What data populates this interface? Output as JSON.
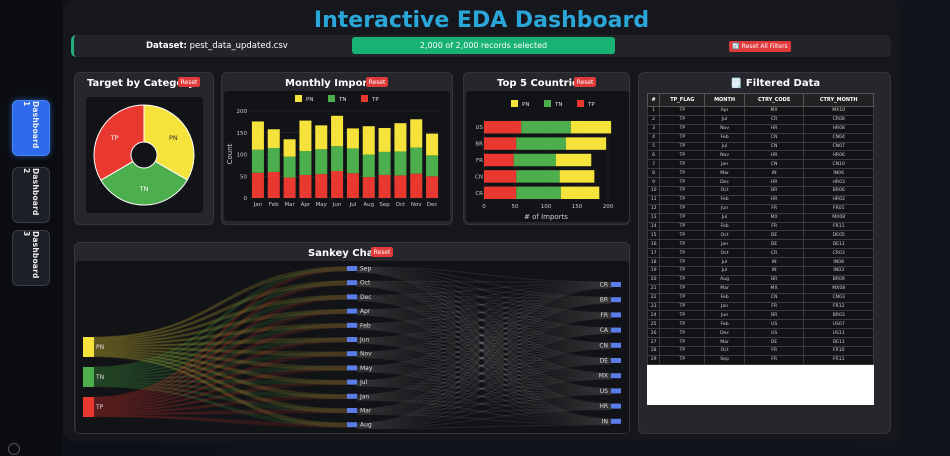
{
  "title": "Interactive EDA Dashboard",
  "nav": [
    {
      "label": "Dashboard 1"
    },
    {
      "label": "Dashboard 2"
    },
    {
      "label": "Dashboard 3"
    }
  ],
  "topbar": {
    "dataset_label": "Dataset:",
    "dataset_file": "pest_data_updated.csv",
    "records": "2,000 of 2,000 records selected",
    "reset_all": "🔄 Reset All Filters"
  },
  "reset_label": "Reset",
  "colors": {
    "PN": "#f5e23a",
    "TN": "#4cae4c",
    "TP": "#e8382f",
    "accent": "#2ba6d8",
    "green": "#19b275",
    "red": "#e03a3a"
  },
  "panels": {
    "target": "Target by Category",
    "monthly": "Monthly Imports",
    "countries": "Top 5 Countries",
    "filtered": "🗒️ Filtered Data",
    "sankey": "Sankey Chart"
  },
  "chart_data": [
    {
      "type": "pie",
      "title": "Target by Category",
      "labels": [
        "PN",
        "TN",
        "TP"
      ],
      "values": [
        33.3,
        33.3,
        33.4
      ],
      "donut": true
    },
    {
      "type": "bar",
      "title": "Monthly Imports",
      "stacked": true,
      "categories": [
        "Jan",
        "Feb",
        "Mar",
        "Apr",
        "May",
        "Jun",
        "Jul",
        "Aug",
        "Sep",
        "Oct",
        "Nov",
        "Dec"
      ],
      "series": [
        {
          "name": "TP",
          "values": [
            58,
            60,
            47,
            53,
            55,
            62,
            57,
            48,
            53,
            52,
            56,
            50
          ]
        },
        {
          "name": "TN",
          "values": [
            53,
            55,
            48,
            55,
            57,
            57,
            57,
            52,
            53,
            55,
            60,
            48
          ]
        },
        {
          "name": "PN",
          "values": [
            65,
            43,
            40,
            70,
            55,
            70,
            46,
            65,
            55,
            65,
            65,
            50
          ]
        }
      ],
      "xlabel": "",
      "ylabel": "Count",
      "ylim": [
        0,
        200
      ],
      "yticks": [
        0,
        50,
        100,
        150,
        200
      ]
    },
    {
      "type": "bar",
      "title": "Top 5 Countries",
      "horizontal": true,
      "stacked": true,
      "categories": [
        "US",
        "BR",
        "FR",
        "CN",
        "CR"
      ],
      "series": [
        {
          "name": "TP",
          "values": [
            60,
            52,
            48,
            52,
            52
          ]
        },
        {
          "name": "TN",
          "values": [
            80,
            80,
            68,
            70,
            72
          ]
        },
        {
          "name": "PN",
          "values": [
            65,
            65,
            57,
            56,
            62
          ]
        }
      ],
      "xlabel": "# of Imports",
      "xlim": [
        0,
        200
      ],
      "xticks": [
        0,
        50,
        100,
        150,
        200
      ]
    },
    {
      "type": "sankey",
      "title": "Sankey Chart",
      "sources": [
        "PN",
        "TN",
        "TP"
      ],
      "months": [
        "Sep",
        "Oct",
        "Dec",
        "Apr",
        "Feb",
        "Jun",
        "Nov",
        "May",
        "Jul",
        "Jan",
        "Mar",
        "Aug"
      ],
      "countries": [
        "CR",
        "BR",
        "FR",
        "CA",
        "CN",
        "DE",
        "MX",
        "US",
        "HR",
        "IN"
      ]
    }
  ],
  "table": {
    "headers": [
      "#",
      "TP_FLAG",
      "MONTH",
      "CTRY_CODE",
      "CTRY_MONTH"
    ],
    "rows": [
      [
        "1",
        "TP",
        "Apr",
        "MX",
        "MX10"
      ],
      [
        "2",
        "TP",
        "Jul",
        "CR",
        "CR08"
      ],
      [
        "3",
        "TP",
        "Nov",
        "HR",
        "HR08"
      ],
      [
        "4",
        "TP",
        "Feb",
        "CN",
        "CN04"
      ],
      [
        "5",
        "TP",
        "Jul",
        "CN",
        "CN07"
      ],
      [
        "6",
        "TP",
        "Nov",
        "HR",
        "HR06"
      ],
      [
        "7",
        "TP",
        "Jan",
        "CN",
        "CN10"
      ],
      [
        "8",
        "TP",
        "Mar",
        "IN",
        "IN06"
      ],
      [
        "9",
        "TP",
        "Dec",
        "HR",
        "HR03"
      ],
      [
        "10",
        "TP",
        "Oct",
        "BR",
        "BR06"
      ],
      [
        "11",
        "TP",
        "Feb",
        "HR",
        "HR02"
      ],
      [
        "12",
        "TP",
        "Jun",
        "FR",
        "FR01"
      ],
      [
        "13",
        "TP",
        "Jul",
        "MX",
        "MX08"
      ],
      [
        "14",
        "TP",
        "Feb",
        "FR",
        "FR11"
      ],
      [
        "15",
        "TP",
        "Oct",
        "DE",
        "DE05"
      ],
      [
        "16",
        "TP",
        "Jan",
        "DE",
        "DE11"
      ],
      [
        "17",
        "TP",
        "Oct",
        "CR",
        "CR03"
      ],
      [
        "18",
        "TP",
        "Jul",
        "IN",
        "IN08"
      ],
      [
        "19",
        "TP",
        "Jul",
        "IN",
        "IN03"
      ],
      [
        "20",
        "TP",
        "Aug",
        "BR",
        "BR09"
      ],
      [
        "21",
        "TP",
        "Mar",
        "MX",
        "MX08"
      ],
      [
        "22",
        "TP",
        "Feb",
        "CN",
        "CN03"
      ],
      [
        "23",
        "TP",
        "Jan",
        "FR",
        "FR12"
      ],
      [
        "24",
        "TP",
        "Jun",
        "BR",
        "BR03"
      ],
      [
        "25",
        "TP",
        "Feb",
        "US",
        "US07"
      ],
      [
        "26",
        "TP",
        "Dec",
        "US",
        "US11"
      ],
      [
        "27",
        "TP",
        "Mar",
        "DE",
        "DE11"
      ],
      [
        "28",
        "TP",
        "Oct",
        "FR",
        "FR10"
      ],
      [
        "29",
        "TP",
        "Sep",
        "FR",
        "FR11"
      ]
    ]
  }
}
